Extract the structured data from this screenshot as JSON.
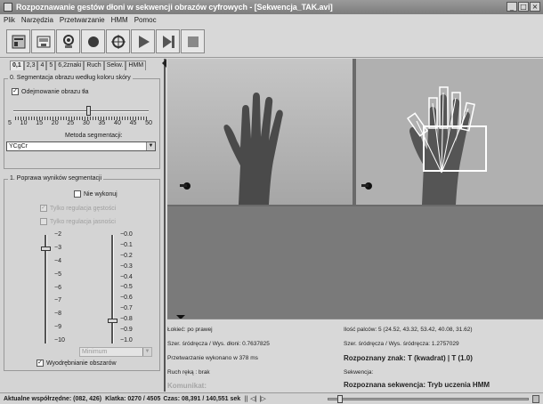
{
  "window": {
    "title": "Rozpoznawanie gestów dłoni w sekwencji obrazów cyfrowych - [Sekwencja_TAK.avi]",
    "min_btn": "_",
    "max_btn": "□",
    "close_btn": "×"
  },
  "menu": [
    "Plik",
    "Narzędzia",
    "Przetwarzanie",
    "HMM",
    "Pomoc"
  ],
  "toolbar": {
    "icons": [
      "open-file-icon",
      "save-icon",
      "camera-icon",
      "record-icon",
      "target-icon",
      "play-icon",
      "step-forward-icon",
      "stop-icon"
    ]
  },
  "tabs": [
    "0,1",
    "2,3",
    "4",
    "5",
    "6,2znaki",
    "Ruch",
    "Sekw.",
    "HMM"
  ],
  "segmentation": {
    "group_title": "0. Segmentacja obrazu według koloru skóry",
    "subtract_bg_label": "Odejmowanie obrazu tła",
    "subtract_bg_checked": true,
    "slider_value": 30,
    "scale_labels": [
      "5",
      "10",
      "15",
      "20",
      "25",
      "30",
      "35",
      "40",
      "45",
      "50"
    ],
    "method_label": "Metoda segmentacji:",
    "method_value": "YCgCr"
  },
  "improve": {
    "group_title": "1. Poprawa wyników segmentacji",
    "do_not_label": "Nie wykonuj",
    "density_label": "Tylko regulacja gęstości",
    "brightness_label": "Tylko regulacja jasności",
    "left_scale": [
      "−2",
      "−3",
      "−4",
      "−5",
      "−6",
      "−7",
      "−8",
      "−9",
      "−10"
    ],
    "right_scale": [
      "−0.0",
      "−0.1",
      "−0.2",
      "−0.3",
      "−0.4",
      "−0.5",
      "−0.6",
      "−0.7",
      "−0.8",
      "−0.9",
      "−1.0"
    ],
    "left_value": -3,
    "right_value": -0.8,
    "select_value": "Minimum",
    "regions_label": "Wyodrębnianie obszarów",
    "regions_checked": true
  },
  "info": {
    "left": {
      "hand_side": "Łokieć: po prawej",
      "ratio": "Szer. śródręcza / Wys. dłoni: 0.7637825",
      "processing": "Przetwarzanie wykonano w 378 ms",
      "movement": "Ruch ręką : brak",
      "message": "Komunikat:"
    },
    "right": {
      "fingers": "Ilość palców: 5 (24.52, 43.32, 53.42, 40.08, 31.62)",
      "palm_ratio": "Szer. śródręcza / Wys. śródręcza: 1.2757029",
      "recognized_sign": "Rozpoznany znak: T (kwadrat) | T (1.0)",
      "sequence_label": "Sekwencja:",
      "recognized_sequence": "Rozpoznana sekwencja: Tryb uczenia HMM"
    }
  },
  "status": {
    "coords": "Aktualne współrzędne: (082, 426)",
    "frame": "Klatka: 0270 / 4505",
    "time": "Czas: 08,391 / 140,551 sek",
    "controls": "|| ◁| |▷",
    "position_fraction": 0.06
  }
}
